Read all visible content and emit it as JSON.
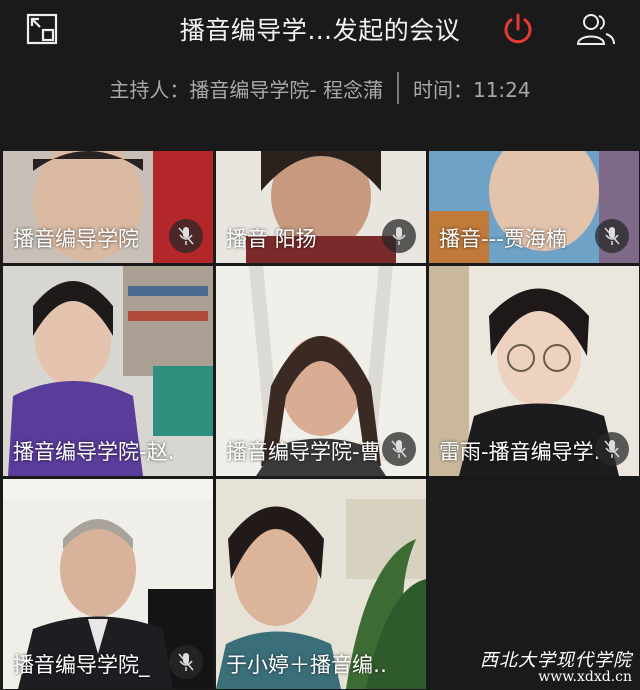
{
  "header": {
    "title": "播音编导学…发起的会议",
    "icons": [
      "exit-fullscreen-icon",
      "power-icon",
      "participants-icon"
    ],
    "power_color": "#e53935"
  },
  "info": {
    "host": "主持人：播音编导学院- 程念蒲",
    "time": "时间：11:24"
  },
  "participants": [
    {
      "name": "播音编导学院"
    },
    {
      "name": "播音 阳扬"
    },
    {
      "name": "播音---贾海楠"
    },
    {
      "name": "播音编导学院-赵…"
    },
    {
      "name": "播音编导学院-曹…"
    },
    {
      "name": "雷雨-播音编导学…"
    },
    {
      "name": "播音编导学院_"
    },
    {
      "name": "于小婷＋播音编…"
    }
  ],
  "watermark": {
    "line1": "西北大学现代学院",
    "line2": "www.xdxd.cn"
  }
}
